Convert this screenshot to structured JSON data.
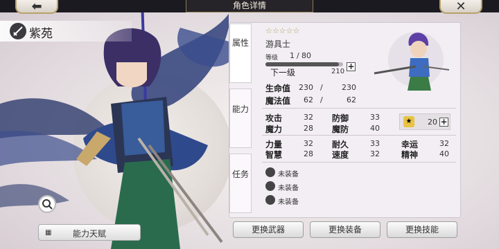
{
  "header": {
    "title": "角色详情",
    "back_icon": "back-arrow-icon",
    "close_icon": "close-icon"
  },
  "character": {
    "name": "紫苑",
    "rarity_stars": 5,
    "job": "游具士"
  },
  "tabs": [
    {
      "label": "属性"
    },
    {
      "label": "能力"
    },
    {
      "label": "任务"
    }
  ],
  "level": {
    "label": "等级",
    "current": "1",
    "separator": "/",
    "max": "80",
    "progress": 0.95,
    "next_label": "下一级",
    "next_value": "210"
  },
  "vitals": [
    {
      "label": "生命值",
      "current": "230",
      "max": "230"
    },
    {
      "label": "魔法值",
      "current": "62",
      "max": "62"
    }
  ],
  "vitals_separator": "/",
  "stats_group1": [
    {
      "label": "攻击",
      "value": "32"
    },
    {
      "label": "防御",
      "value": "33"
    },
    {
      "label": "魔力",
      "value": "28"
    },
    {
      "label": "魔防",
      "value": "40"
    }
  ],
  "bonus_points": {
    "value": "20",
    "icon": "points-icon"
  },
  "stats_group2": [
    {
      "label": "力量",
      "value": "32"
    },
    {
      "label": "耐久",
      "value": "33"
    },
    {
      "label": "幸运",
      "value": "32"
    },
    {
      "label": "智慧",
      "value": "28"
    },
    {
      "label": "速度",
      "value": "32"
    },
    {
      "label": "精神",
      "value": "40"
    }
  ],
  "equipment": [
    {
      "label": "未装备",
      "icon": "weapon-slot-icon"
    },
    {
      "label": "未装备",
      "icon": "armor-slot-icon"
    },
    {
      "label": "未装备",
      "icon": "skill-slot-icon"
    }
  ],
  "buttons": {
    "talent": "能力天赋",
    "change_weapon": "更换武器",
    "change_equipment": "更换装备",
    "change_skill": "更换技能"
  }
}
